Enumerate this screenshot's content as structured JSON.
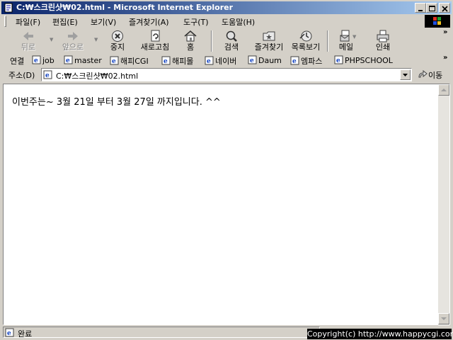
{
  "window": {
    "title": "C:₩스크린샷₩02.html - Microsoft Internet Explorer"
  },
  "menu": {
    "items": [
      "파일(F)",
      "편집(E)",
      "보기(V)",
      "즐겨찾기(A)",
      "도구(T)",
      "도움말(H)"
    ]
  },
  "toolbar": {
    "back": "뒤로",
    "forward": "앞으로",
    "stop": "중지",
    "refresh": "새로고침",
    "home": "홈",
    "search": "검색",
    "favorites": "즐겨찾기",
    "history": "목록보기",
    "mail": "메일",
    "print": "인쇄"
  },
  "links": {
    "label": "연결",
    "items": [
      "job",
      "master",
      "해피CGI",
      "해피몰",
      "네이버",
      "Daum",
      "엠파스",
      "PHPSCHOOL"
    ]
  },
  "address": {
    "label": "주소(D)",
    "value": "C:₩스크린샷₩02.html",
    "go": "이동"
  },
  "page": {
    "text": "이번주는~ 3월 21일 부터 3월 27일 까지입니다. ^^"
  },
  "status": {
    "text": "완료",
    "copyright": "Copyright(c) http://www.happycgi.com"
  },
  "colors": {
    "titlebar_start": "#0a246a",
    "titlebar_end": "#a6caf0",
    "chrome": "#d4d0c8"
  }
}
